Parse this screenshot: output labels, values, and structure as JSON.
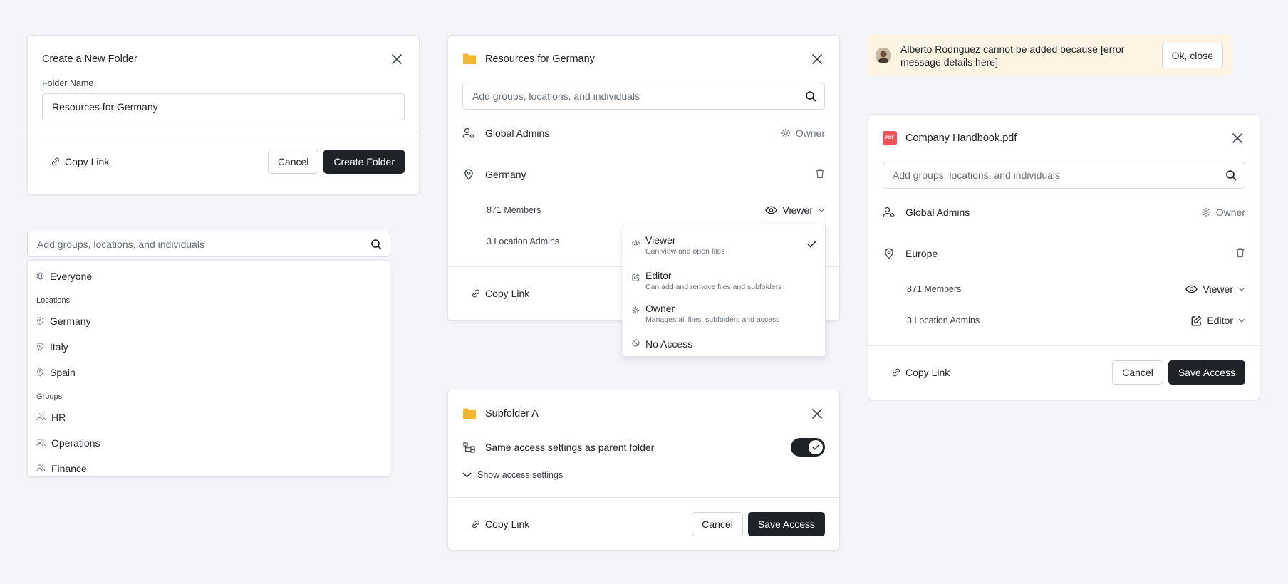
{
  "create_folder": {
    "title": "Create a New Folder",
    "field_label": "Folder Name",
    "field_value": "Resources for Germany",
    "copy_link": "Copy Link",
    "cancel": "Cancel",
    "submit": "Create Folder"
  },
  "search_panel": {
    "placeholder": "Add groups, locations, and individuals",
    "everyone": "Everyone",
    "locations_heading": "Locations",
    "locations": [
      "Germany",
      "Italy",
      "Spain"
    ],
    "groups_heading": "Groups",
    "groups": [
      "HR",
      "Operations",
      "Finance"
    ]
  },
  "resources_dialog": {
    "title": "Resources for Germany",
    "placeholder": "Add groups, locations, and individuals",
    "global_admins": "Global Admins",
    "owner_label": "Owner",
    "location": "Germany",
    "members": "871 Members",
    "members_role": "Viewer",
    "location_admins": "3 Location Admins",
    "copy_link": "Copy Link"
  },
  "role_menu": {
    "items": [
      {
        "title": "Viewer",
        "desc": "Can view and open files"
      },
      {
        "title": "Editor",
        "desc": "Can add and remove files and subfolders"
      },
      {
        "title": "Owner",
        "desc": "Manages all files, subfolders and access"
      },
      {
        "title": "No Access",
        "desc": ""
      }
    ]
  },
  "subfolder_dialog": {
    "title": "Subfolder A",
    "same_access": "Same access settings as parent folder",
    "show_access": "Show access settings",
    "copy_link": "Copy Link",
    "cancel": "Cancel",
    "save": "Save Access"
  },
  "toast": {
    "message": "Alberto Rodriguez cannot be added because [error message details here]",
    "button": "Ok, close"
  },
  "handbook_dialog": {
    "title": "Company Handbook.pdf",
    "pdf_badge": "PDF",
    "placeholder": "Add groups, locations, and individuals",
    "global_admins": "Global Admins",
    "owner_label": "Owner",
    "location": "Europe",
    "members": "871 Members",
    "members_role": "Viewer",
    "location_admins": "3 Location Admins",
    "admins_role": "Editor",
    "copy_link": "Copy Link",
    "cancel": "Cancel",
    "save": "Save Access"
  },
  "colors": {
    "background": "#f4f5f9",
    "dark_button": "#1f2328",
    "folder": "#f5b52e",
    "pdf": "#f0525a",
    "toast_bg": "#fdf4e4"
  }
}
